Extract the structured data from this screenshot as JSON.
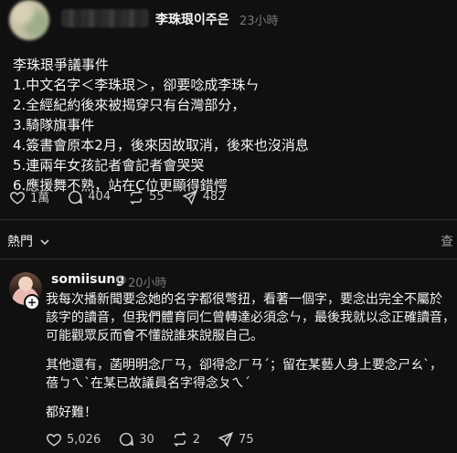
{
  "top_post": {
    "username": "李珠珢이주은",
    "time": "23小時",
    "lines": [
      "李珠珢爭議事件",
      "1.中文名字＜李珠珢＞，卻要唸成李珠ㄣ",
      "2.全經紀約後來被揭穿只有台灣部分，",
      "3.騎隊旗事件",
      "4.簽書會原本2月，後來因故取消，後來也沒消息",
      "5.連兩年女孩記者會記者會哭哭",
      "6.應援舞不熟，站在C位更顯得錯愕"
    ],
    "likes": "1萬",
    "comments": "404",
    "reposts": "55",
    "shares": "482"
  },
  "sort": {
    "label": "熱門",
    "view_label": "查"
  },
  "reply": {
    "username": "somiisung",
    "time": "20小時",
    "paragraph1": [
      "我每次播新聞要念她的名字都很彆扭，看著一個字，要念出完全不屬於",
      "該字的讀音，但我們體育同仁曾轉達必須念ㄣ，最後我就以念正確讀音，",
      "可能觀眾反而會不懂說誰來說服自己。"
    ],
    "paragraph2": [
      "其他還有，菡明明念ㄏㄢ，卻得念ㄏㄢˊ；留在某藝人身上要念ㄕㄠˋ，",
      "蓓ㄅㄟˋ在某已故議員名字得念ㄆㄟˊ"
    ],
    "paragraph3": "都好難！",
    "likes": "5,026",
    "comments": "30",
    "reposts": "2",
    "shares": "75"
  }
}
